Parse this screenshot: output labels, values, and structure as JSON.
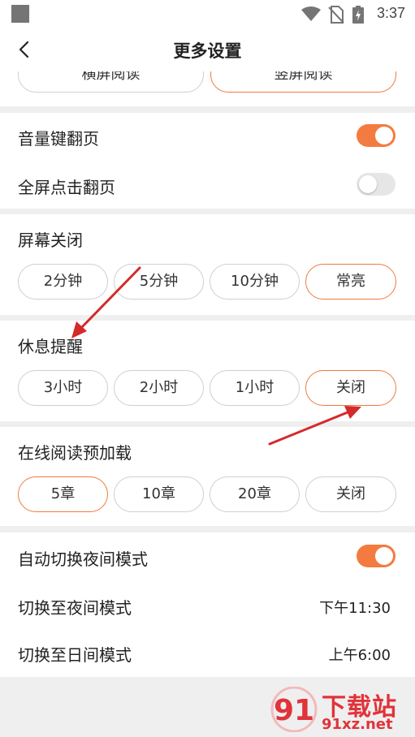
{
  "status_bar": {
    "time": "3:37"
  },
  "header": {
    "title": "更多设置"
  },
  "orientation": {
    "options": [
      "横屏阅读",
      "竖屏阅读"
    ],
    "selected_index": 1
  },
  "page_turn": {
    "volume_keys": {
      "label": "音量键翻页",
      "enabled": true
    },
    "fullscreen_tap": {
      "label": "全屏点击翻页",
      "enabled": false
    }
  },
  "screen_off": {
    "title": "屏幕关闭",
    "options": [
      "2分钟",
      "5分钟",
      "10分钟",
      "常亮"
    ],
    "selected_index": 3
  },
  "rest_reminder": {
    "title": "休息提醒",
    "options": [
      "3小时",
      "2小时",
      "1小时",
      "关闭"
    ],
    "selected_index": 3
  },
  "preload": {
    "title": "在线阅读预加载",
    "options": [
      "5章",
      "10章",
      "20章",
      "关闭"
    ],
    "selected_index": 0
  },
  "night_mode": {
    "auto_switch": {
      "label": "自动切换夜间模式",
      "enabled": true
    },
    "to_night": {
      "label": "切换至夜间模式",
      "value": "下午11:30"
    },
    "to_day": {
      "label": "切换至日间模式",
      "value": "上午6:00"
    }
  },
  "watermark": {
    "title": "下载站",
    "url": "91xz.net",
    "logo": "91"
  },
  "colors": {
    "accent": "#f47b3f",
    "annotation_arrow": "#d42a2a",
    "watermark": "#e0333a"
  }
}
